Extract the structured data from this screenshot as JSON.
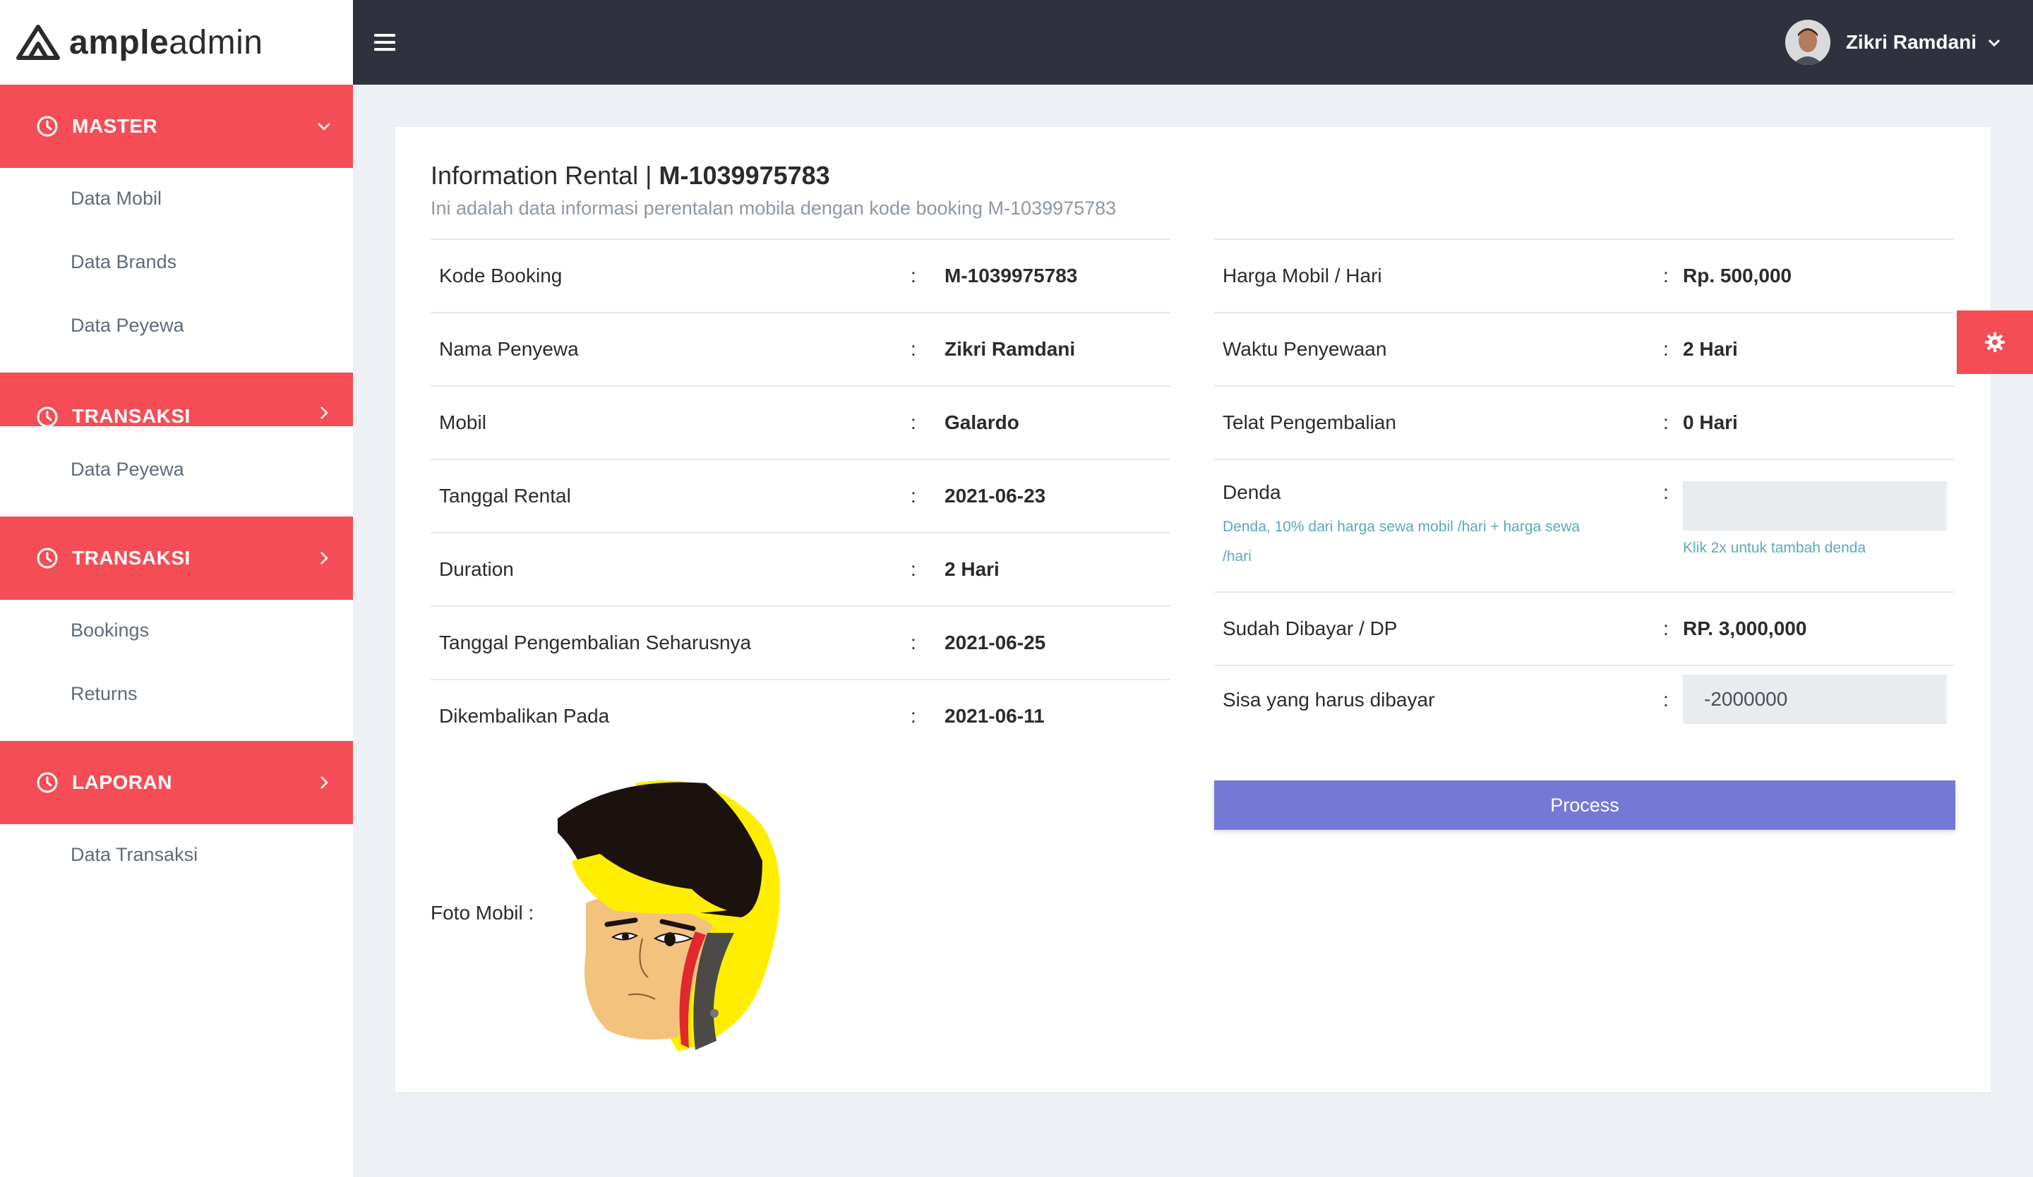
{
  "app": {
    "logo_bold": "ample",
    "logo_light": "admin"
  },
  "sidebar": {
    "sections": [
      {
        "label": "MASTER",
        "arrow": "chevron-down",
        "items": [
          "Data Mobil",
          "Data Brands",
          "Data Peyewa"
        ]
      },
      {
        "label": "TRANSAKSI",
        "arrow": "chevron-right",
        "items": [
          "Data Peyewa"
        ]
      },
      {
        "label": "TRANSAKSI",
        "arrow": "chevron-right",
        "items": [
          "Bookings",
          "Returns"
        ]
      },
      {
        "label": "LAPORAN",
        "arrow": "chevron-right",
        "items": [
          "Data Transaksi"
        ]
      }
    ]
  },
  "topbar": {
    "user_name": "Zikri Ramdani"
  },
  "page": {
    "title_prefix": "Information Rental | ",
    "title_code": "M-1039975783",
    "subtitle": "Ini adalah data informasi perentalan mobila dengan kode booking M-1039975783"
  },
  "left_details": [
    {
      "label": "Kode Booking",
      "value": "M-1039975783"
    },
    {
      "label": "Nama Penyewa",
      "value": "Zikri Ramdani"
    },
    {
      "label": "Mobil",
      "value": "Galardo"
    },
    {
      "label": "Tanggal Rental",
      "value": "2021-06-23"
    },
    {
      "label": "Duration",
      "value": "2 Hari"
    },
    {
      "label": "Tanggal Pengembalian Seharusnya",
      "value": "2021-06-25"
    },
    {
      "label": "Dikembalikan Pada",
      "value": "2021-06-11"
    }
  ],
  "right_details": {
    "harga": {
      "label": "Harga Mobil / Hari",
      "value": "Rp. 500,000"
    },
    "waktu": {
      "label": "Waktu Penyewaan",
      "value": "2 Hari"
    },
    "telat": {
      "label": "Telat Pengembalian",
      "value": "0 Hari"
    },
    "denda": {
      "label": "Denda",
      "hint_line1": "Denda, 10% dari harga sewa mobil /hari + harga sewa",
      "hint_line2": "/hari",
      "value": "",
      "field_hint": "Klik 2x untuk tambah denda"
    },
    "dibayar": {
      "label": "Sudah Dibayar / DP",
      "value": "RP. 3,000,000"
    },
    "sisa": {
      "label": "Sisa yang harus dibayar",
      "value": "-2000000"
    }
  },
  "colon": ":",
  "process_button": "Process",
  "foto_label": "Foto Mobil :",
  "colors": {
    "accent_red": "#f54d55",
    "topbar": "#2f323e",
    "button": "#7579d6",
    "hint": "#5ea8b8"
  },
  "icons": [
    "hamburger-icon",
    "clock-icon",
    "chevron-down-icon",
    "chevron-right-icon",
    "gear-icon",
    "logo-icon"
  ]
}
